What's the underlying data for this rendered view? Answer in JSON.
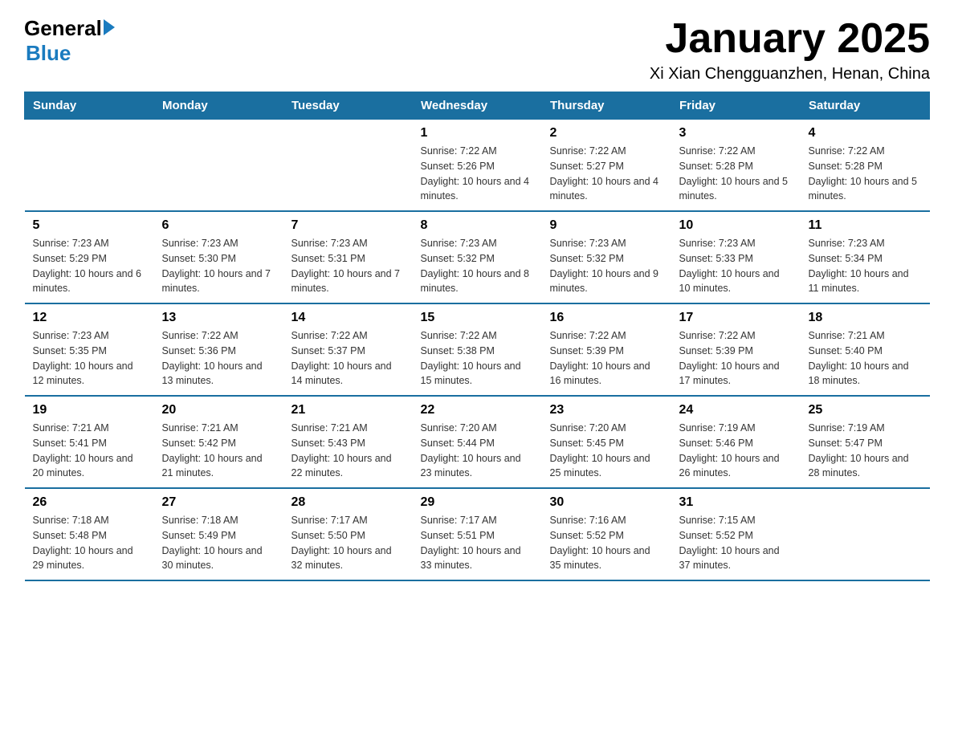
{
  "logo": {
    "general": "General",
    "arrow": "▶",
    "blue": "Blue"
  },
  "title": "January 2025",
  "subtitle": "Xi Xian Chengguanzhen, Henan, China",
  "weekdays": [
    "Sunday",
    "Monday",
    "Tuesday",
    "Wednesday",
    "Thursday",
    "Friday",
    "Saturday"
  ],
  "weeks": [
    [
      {
        "day": "",
        "info": ""
      },
      {
        "day": "",
        "info": ""
      },
      {
        "day": "",
        "info": ""
      },
      {
        "day": "1",
        "info": "Sunrise: 7:22 AM\nSunset: 5:26 PM\nDaylight: 10 hours and 4 minutes."
      },
      {
        "day": "2",
        "info": "Sunrise: 7:22 AM\nSunset: 5:27 PM\nDaylight: 10 hours and 4 minutes."
      },
      {
        "day": "3",
        "info": "Sunrise: 7:22 AM\nSunset: 5:28 PM\nDaylight: 10 hours and 5 minutes."
      },
      {
        "day": "4",
        "info": "Sunrise: 7:22 AM\nSunset: 5:28 PM\nDaylight: 10 hours and 5 minutes."
      }
    ],
    [
      {
        "day": "5",
        "info": "Sunrise: 7:23 AM\nSunset: 5:29 PM\nDaylight: 10 hours and 6 minutes."
      },
      {
        "day": "6",
        "info": "Sunrise: 7:23 AM\nSunset: 5:30 PM\nDaylight: 10 hours and 7 minutes."
      },
      {
        "day": "7",
        "info": "Sunrise: 7:23 AM\nSunset: 5:31 PM\nDaylight: 10 hours and 7 minutes."
      },
      {
        "day": "8",
        "info": "Sunrise: 7:23 AM\nSunset: 5:32 PM\nDaylight: 10 hours and 8 minutes."
      },
      {
        "day": "9",
        "info": "Sunrise: 7:23 AM\nSunset: 5:32 PM\nDaylight: 10 hours and 9 minutes."
      },
      {
        "day": "10",
        "info": "Sunrise: 7:23 AM\nSunset: 5:33 PM\nDaylight: 10 hours and 10 minutes."
      },
      {
        "day": "11",
        "info": "Sunrise: 7:23 AM\nSunset: 5:34 PM\nDaylight: 10 hours and 11 minutes."
      }
    ],
    [
      {
        "day": "12",
        "info": "Sunrise: 7:23 AM\nSunset: 5:35 PM\nDaylight: 10 hours and 12 minutes."
      },
      {
        "day": "13",
        "info": "Sunrise: 7:22 AM\nSunset: 5:36 PM\nDaylight: 10 hours and 13 minutes."
      },
      {
        "day": "14",
        "info": "Sunrise: 7:22 AM\nSunset: 5:37 PM\nDaylight: 10 hours and 14 minutes."
      },
      {
        "day": "15",
        "info": "Sunrise: 7:22 AM\nSunset: 5:38 PM\nDaylight: 10 hours and 15 minutes."
      },
      {
        "day": "16",
        "info": "Sunrise: 7:22 AM\nSunset: 5:39 PM\nDaylight: 10 hours and 16 minutes."
      },
      {
        "day": "17",
        "info": "Sunrise: 7:22 AM\nSunset: 5:39 PM\nDaylight: 10 hours and 17 minutes."
      },
      {
        "day": "18",
        "info": "Sunrise: 7:21 AM\nSunset: 5:40 PM\nDaylight: 10 hours and 18 minutes."
      }
    ],
    [
      {
        "day": "19",
        "info": "Sunrise: 7:21 AM\nSunset: 5:41 PM\nDaylight: 10 hours and 20 minutes."
      },
      {
        "day": "20",
        "info": "Sunrise: 7:21 AM\nSunset: 5:42 PM\nDaylight: 10 hours and 21 minutes."
      },
      {
        "day": "21",
        "info": "Sunrise: 7:21 AM\nSunset: 5:43 PM\nDaylight: 10 hours and 22 minutes."
      },
      {
        "day": "22",
        "info": "Sunrise: 7:20 AM\nSunset: 5:44 PM\nDaylight: 10 hours and 23 minutes."
      },
      {
        "day": "23",
        "info": "Sunrise: 7:20 AM\nSunset: 5:45 PM\nDaylight: 10 hours and 25 minutes."
      },
      {
        "day": "24",
        "info": "Sunrise: 7:19 AM\nSunset: 5:46 PM\nDaylight: 10 hours and 26 minutes."
      },
      {
        "day": "25",
        "info": "Sunrise: 7:19 AM\nSunset: 5:47 PM\nDaylight: 10 hours and 28 minutes."
      }
    ],
    [
      {
        "day": "26",
        "info": "Sunrise: 7:18 AM\nSunset: 5:48 PM\nDaylight: 10 hours and 29 minutes."
      },
      {
        "day": "27",
        "info": "Sunrise: 7:18 AM\nSunset: 5:49 PM\nDaylight: 10 hours and 30 minutes."
      },
      {
        "day": "28",
        "info": "Sunrise: 7:17 AM\nSunset: 5:50 PM\nDaylight: 10 hours and 32 minutes."
      },
      {
        "day": "29",
        "info": "Sunrise: 7:17 AM\nSunset: 5:51 PM\nDaylight: 10 hours and 33 minutes."
      },
      {
        "day": "30",
        "info": "Sunrise: 7:16 AM\nSunset: 5:52 PM\nDaylight: 10 hours and 35 minutes."
      },
      {
        "day": "31",
        "info": "Sunrise: 7:15 AM\nSunset: 5:52 PM\nDaylight: 10 hours and 37 minutes."
      },
      {
        "day": "",
        "info": ""
      }
    ]
  ]
}
